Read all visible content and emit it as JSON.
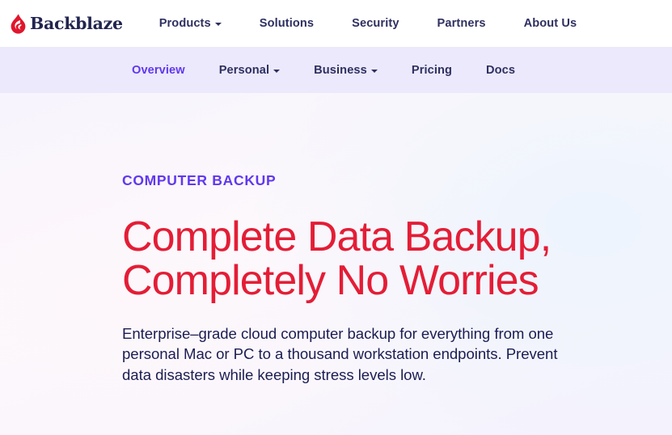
{
  "brand": {
    "name": "Backblaze",
    "logo_icon": "flame-icon",
    "logo_color": "#e0172c",
    "wordmark_color": "#21244f"
  },
  "header": {
    "nav": [
      {
        "label": "Products",
        "has_dropdown": true,
        "icon": "chevron-down-icon"
      },
      {
        "label": "Solutions",
        "has_dropdown": false
      },
      {
        "label": "Security",
        "has_dropdown": false
      },
      {
        "label": "Partners",
        "has_dropdown": false
      },
      {
        "label": "About Us",
        "has_dropdown": false
      }
    ]
  },
  "subnav": {
    "background_color": "#ebe9fb",
    "active_color": "#6138ef",
    "items": [
      {
        "label": "Overview",
        "active": true,
        "has_dropdown": false
      },
      {
        "label": "Personal",
        "active": false,
        "has_dropdown": true,
        "icon": "chevron-down-icon"
      },
      {
        "label": "Business",
        "active": false,
        "has_dropdown": true,
        "icon": "chevron-down-icon"
      },
      {
        "label": "Pricing",
        "active": false,
        "has_dropdown": false
      },
      {
        "label": "Docs",
        "active": false,
        "has_dropdown": false
      }
    ]
  },
  "hero": {
    "eyebrow": "COMPUTER BACKUP",
    "eyebrow_color": "#6138ef",
    "headline": "Complete Data Backup,\nCompletely No Worries",
    "headline_color": "#e41d36",
    "subcopy": "Enterprise–grade cloud computer backup for everything from one\npersonal Mac or PC to a thousand workstation endpoints. Prevent\ndata disasters while keeping stress levels low.",
    "subcopy_color": "#1b1d52"
  }
}
